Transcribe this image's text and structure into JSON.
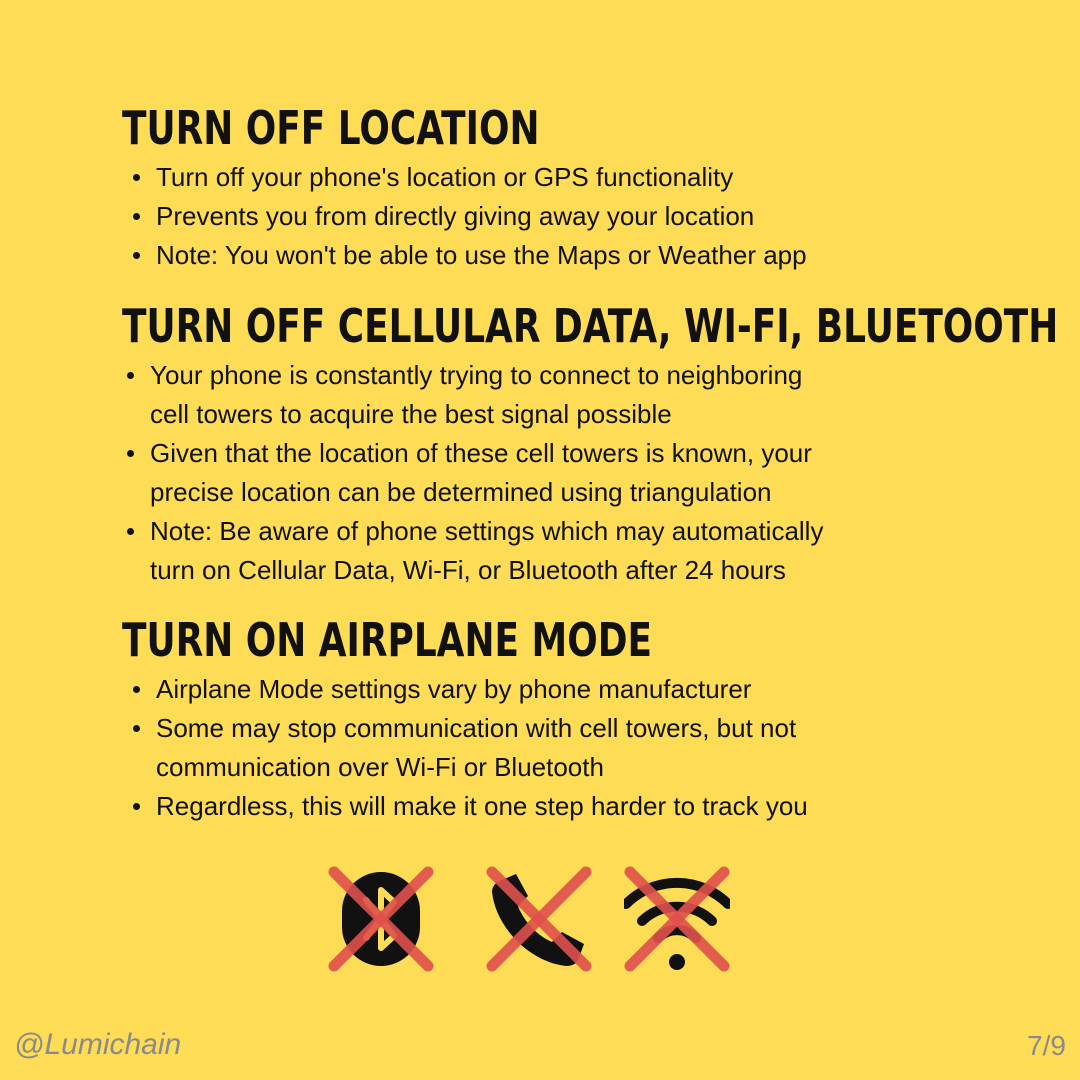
{
  "sections": [
    {
      "title": "TURN OFF LOCATION",
      "bullets": [
        "Turn off your phone's location or GPS functionality",
        "Prevents you from directly giving away your location",
        "Note: You won't be able to use the Maps or Weather app"
      ]
    },
    {
      "title": "TURN OFF CELLULAR DATA, WI-FI, BLUETOOTH",
      "bullets": [
        "Your phone is constantly trying to connect to neighboring\ncell towers to acquire the best signal possible",
        "Given that the location of these cell towers is known, your\nprecise location can be determined using triangulation",
        "Note: Be aware of phone settings which may automatically\nturn on Cellular Data, Wi-Fi, or Bluetooth after 24 hours"
      ]
    },
    {
      "title": "TURN ON AIRPLANE MODE",
      "bullets": [
        "Airplane Mode settings vary by phone manufacturer",
        "Some may stop communication with cell towers, but not\ncommunication over Wi-Fi or Bluetooth",
        "Regardless, this will make it one step harder to track you"
      ]
    }
  ],
  "icons": [
    "bluetooth-icon",
    "phone-icon",
    "wifi-icon"
  ],
  "footer": {
    "handle": "@Lumichain",
    "page": "7/9"
  },
  "colors": {
    "background": "#FEDC56",
    "text": "#111111",
    "cross": "#E0504C",
    "footer_text": "#8A8A8A"
  }
}
